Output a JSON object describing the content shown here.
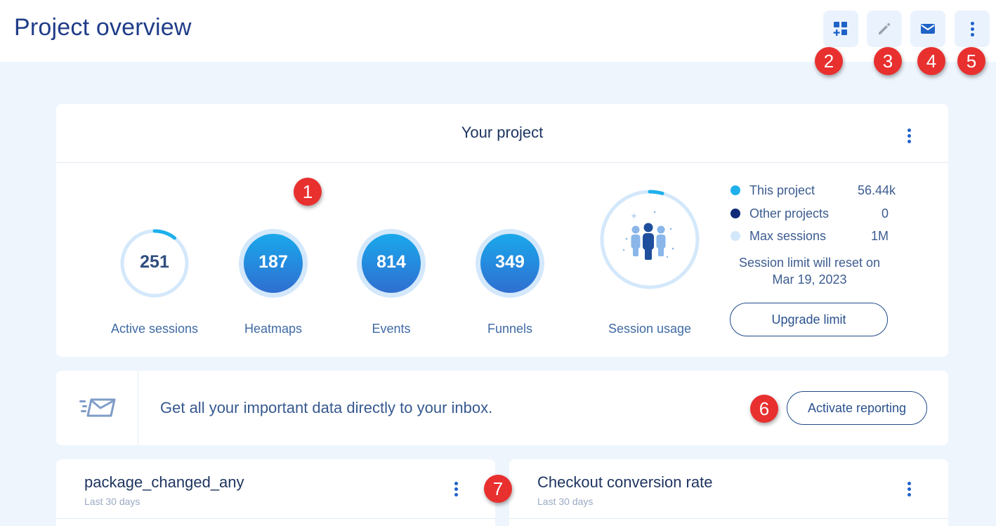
{
  "header": {
    "title": "Project overview",
    "actions": [
      {
        "name": "add-widget",
        "icon": "dashboard-add-icon"
      },
      {
        "name": "edit",
        "icon": "pencil-icon"
      },
      {
        "name": "email",
        "icon": "envelope-icon"
      },
      {
        "name": "more",
        "icon": "kebab-icon"
      }
    ]
  },
  "markers": [
    "1",
    "2",
    "3",
    "4",
    "5",
    "6",
    "7"
  ],
  "project": {
    "title": "Your project",
    "stats": [
      {
        "value": "251",
        "label": "Active sessions"
      },
      {
        "value": "187",
        "label": "Heatmaps"
      },
      {
        "value": "814",
        "label": "Events"
      },
      {
        "value": "349",
        "label": "Funnels"
      }
    ],
    "session_usage": {
      "label": "Session usage",
      "legend": [
        {
          "label": "This project",
          "value": "56.44k",
          "color": "#1fb0ec"
        },
        {
          "label": "Other projects",
          "value": "0",
          "color": "#0e2a78"
        },
        {
          "label": "Max sessions",
          "value": "1M",
          "color": "#d4e8fb"
        }
      ],
      "reset_note": "Session limit will reset on Mar 19, 2023",
      "upgrade_label": "Upgrade limit"
    }
  },
  "reporting": {
    "text": "Get all your important data directly to your inbox.",
    "button_label": "Activate reporting"
  },
  "widgets": [
    {
      "title": "package_changed_any",
      "subtitle": "Last 30 days"
    },
    {
      "title": "Checkout conversion rate",
      "subtitle": "Last 30 days"
    }
  ],
  "colors": {
    "accent": "#1f62c8",
    "title": "#1f3c88",
    "marker": "#e8302f",
    "background": "#eef5fd"
  }
}
